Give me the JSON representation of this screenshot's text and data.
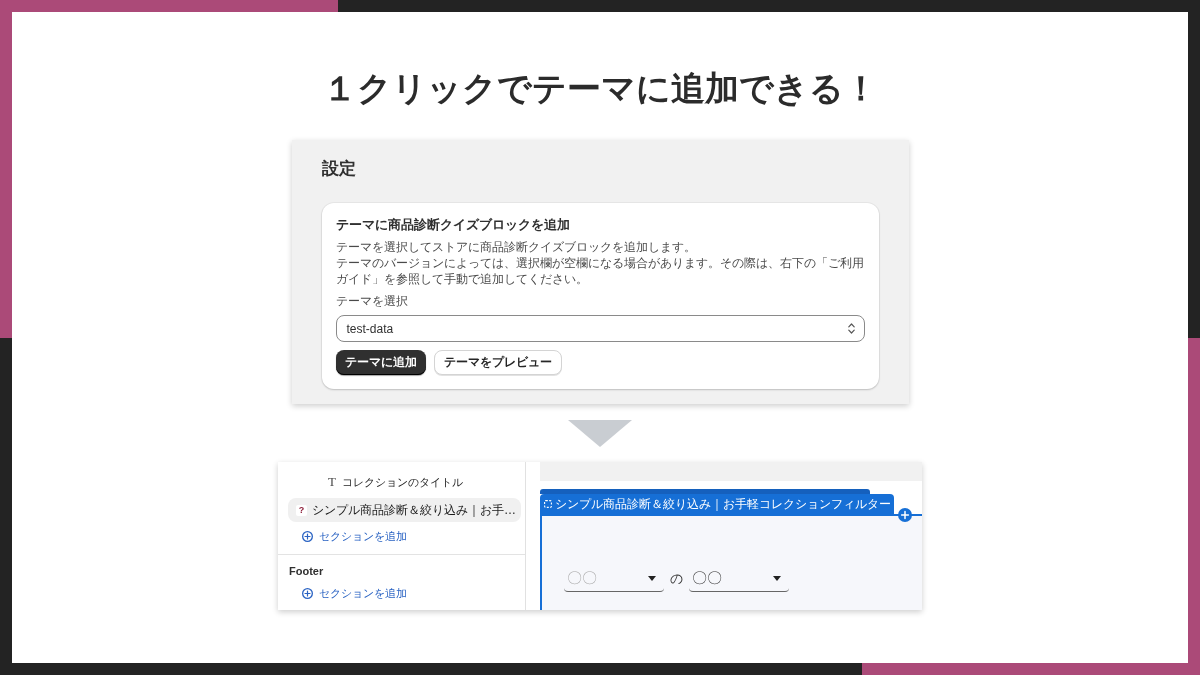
{
  "slide_title": "１クリックでテーマに追加できる！",
  "settings_screenshot": {
    "page_title": "設定",
    "card": {
      "title": "テーマに商品診断クイズブロックを追加",
      "description": [
        "テーマを選択してストアに商品診断クイズブロックを追加します。",
        "テーマのバージョンによっては、選択欄が空欄になる場合があります。その際は、右下の「ご利用ガイド」を参照して手動で追加してください。"
      ],
      "select": {
        "label": "テーマを選択",
        "value": "test-data"
      },
      "buttons": [
        {
          "label": "テーマに追加",
          "kind": "primary"
        },
        {
          "label": "テーマをプレビュー",
          "kind": "secondary"
        }
      ]
    }
  },
  "editor_screenshot": {
    "sidebar": {
      "groups": [
        {
          "items": [
            {
              "kind": "text-block",
              "icon": "T",
              "label": "コレクションのタイトル",
              "selected": false
            },
            {
              "kind": "app-block",
              "icon": "?",
              "label": "シンプル商品診断＆絞り込み｜お手…",
              "selected": true
            },
            {
              "kind": "add-section",
              "label": "セクションを追加",
              "selected": false
            }
          ]
        },
        {
          "title": "Footer",
          "items": [
            {
              "kind": "add-section",
              "label": "セクションを追加",
              "selected": false
            }
          ]
        }
      ]
    },
    "preview": {
      "block_label": "シンプル商品診断＆絞り込み｜お手軽コレクションフィルター",
      "filter_row": [
        {
          "kind": "dropdown",
          "placeholder": "〇〇"
        },
        {
          "kind": "text",
          "text": "の"
        },
        {
          "kind": "dropdown",
          "value": "〇〇"
        }
      ]
    }
  }
}
